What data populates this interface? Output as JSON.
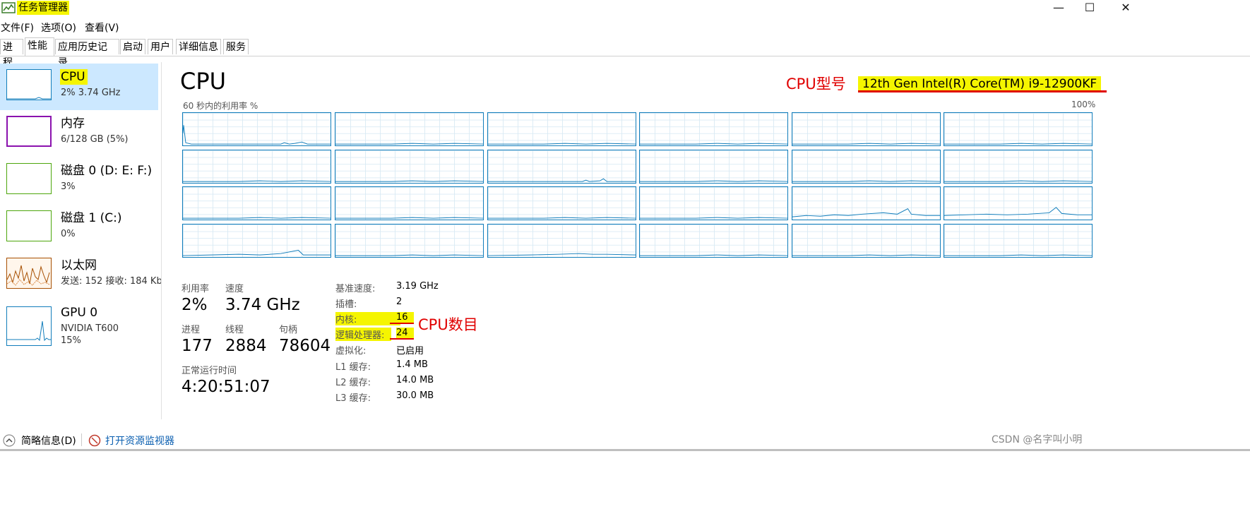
{
  "window": {
    "title": "任务管理器",
    "controls": {
      "minimize": "—",
      "maximize": "☐",
      "close": "✕"
    }
  },
  "menu": [
    "文件(F)",
    "选项(O)",
    "查看(V)"
  ],
  "tabs": [
    {
      "label": "进程",
      "active": false
    },
    {
      "label": "性能",
      "active": true
    },
    {
      "label": "应用历史记录",
      "active": false
    },
    {
      "label": "启动",
      "active": false
    },
    {
      "label": "用户",
      "active": false
    },
    {
      "label": "详细信息",
      "active": false
    },
    {
      "label": "服务",
      "active": false
    }
  ],
  "sidebar": {
    "items": [
      {
        "title": "CPU",
        "sub": "2% 3.74 GHz",
        "color": "#117dbb",
        "selected": true,
        "icon": "cpu-graph-icon"
      },
      {
        "title": "内存",
        "sub": "6/128 GB (5%)",
        "color": "#8b12ae",
        "selected": false,
        "icon": "memory-graph-icon"
      },
      {
        "title": "磁盘 0 (D: E: F:)",
        "sub": "3%",
        "color": "#4da60c",
        "selected": false,
        "icon": "disk-graph-icon"
      },
      {
        "title": "磁盘 1 (C:)",
        "sub": "0%",
        "color": "#4da60c",
        "selected": false,
        "icon": "disk-graph-icon"
      },
      {
        "title": "以太网",
        "sub": "发送: 152 接收: 184 Kb",
        "color": "#a74f01",
        "selected": false,
        "icon": "ethernet-graph-icon"
      },
      {
        "title": "GPU 0",
        "sub": "NVIDIA T600",
        "sub2": "15%",
        "color": "#117dbb",
        "selected": false,
        "icon": "gpu-graph-icon"
      }
    ]
  },
  "main": {
    "heading": "CPU",
    "model_label": "CPU型号",
    "model_name": "12th Gen Intel(R) Core(TM) i9-12900KF",
    "graph_caption": "60 秒内的利用率 %",
    "graph_max": "100%",
    "graph_color": "#117dbb",
    "core_count_label": "CPU数目"
  },
  "stats": {
    "utilization": {
      "label": "利用率",
      "value": "2%"
    },
    "speed": {
      "label": "速度",
      "value": "3.74 GHz"
    },
    "processes": {
      "label": "进程",
      "value": "177"
    },
    "threads": {
      "label": "线程",
      "value": "2884"
    },
    "handles": {
      "label": "句柄",
      "value": "78604"
    },
    "uptime": {
      "label": "正常运行时间",
      "value": "4:20:51:07"
    }
  },
  "details": [
    {
      "label": "基准速度:",
      "value": "3.19 GHz"
    },
    {
      "label": "插槽:",
      "value": "2"
    },
    {
      "label": "内核:",
      "value": "16"
    },
    {
      "label": "逻辑处理器:",
      "value": "24"
    },
    {
      "label": "虚拟化:",
      "value": "已启用"
    },
    {
      "label": "L1 缓存:",
      "value": "1.4 MB"
    },
    {
      "label": "L2 缓存:",
      "value": "14.0 MB"
    },
    {
      "label": "L3 缓存:",
      "value": "30.0 MB"
    }
  ],
  "footer": {
    "fewer_details": "简略信息(D)",
    "open_monitor": "打开资源监视器"
  },
  "watermark": "CSDN @名字叫小明"
}
